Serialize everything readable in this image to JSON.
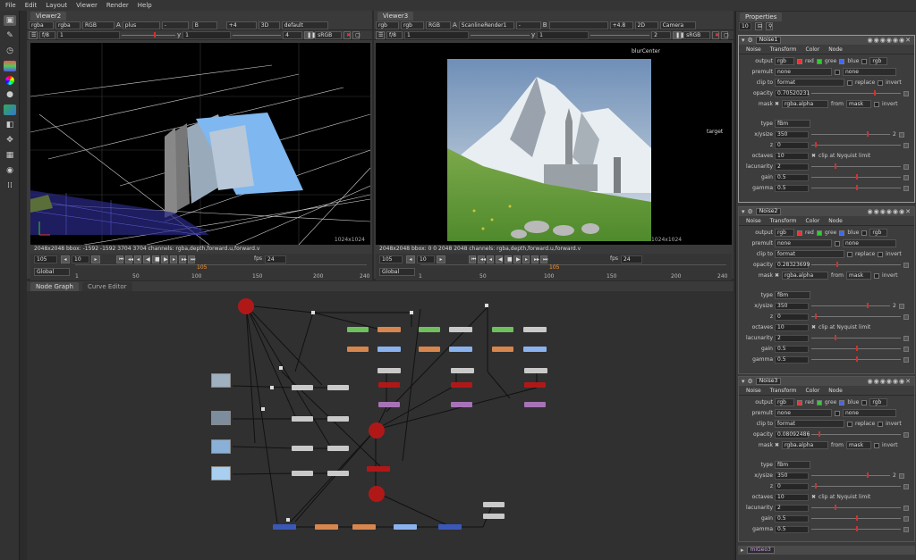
{
  "menu": [
    "File",
    "Edit",
    "Layout",
    "Viewer",
    "Render",
    "Help"
  ],
  "viewer_left": {
    "tab": "Viewer2",
    "row1": [
      "rgba",
      "rgba",
      "RGB",
      "A",
      "plus",
      "-",
      "B",
      "",
      "+4",
      "3D",
      "default"
    ],
    "row2": [
      "f/8",
      "1",
      "y",
      "1",
      "4",
      "sRGB"
    ],
    "status": "2048x2048  bbox: -1592 -1592 3704 3704 channels: rgba,depth,forward.u,forward.v",
    "resolution": "1024x1024",
    "frame": "105",
    "step": "10",
    "fps_label": "fps",
    "fps": "24",
    "range": "Global",
    "ticks": [
      "1",
      "50",
      "100",
      "150",
      "200",
      "240"
    ],
    "marker": "105"
  },
  "viewer_right": {
    "tab": "Viewer3",
    "row1": [
      "rgb",
      "rgb",
      "RGB",
      "A",
      "ScanlineRender1",
      "-",
      "B",
      "",
      "+4.8",
      "2D",
      "Camera"
    ],
    "row2": [
      "f/8",
      "1",
      "y",
      "1",
      "2",
      "sRGB"
    ],
    "status": "2048x2048  bbox: 0 0 2048 2048 channels: rgba,depth,forward.u,forward.v",
    "resolution": "1024x1024",
    "label_blur": "blurCenter",
    "label_target": "target",
    "frame": "105",
    "step": "10",
    "fps_label": "fps",
    "fps": "24",
    "range": "Global",
    "ticks": [
      "1",
      "50",
      "100",
      "150",
      "200",
      "240"
    ],
    "marker": "105"
  },
  "nodegraph": {
    "tabs": [
      "Node Graph",
      "Curve Editor"
    ]
  },
  "properties": {
    "title": "Properties",
    "count": "10",
    "panels": [
      {
        "name": "Noise1",
        "opacity": "0.70520231",
        "mask": "rgba.alpha"
      },
      {
        "name": "Noise2",
        "opacity": "0.28323699",
        "mask": "rgba.alpha"
      },
      {
        "name": "Noise3",
        "opacity": "0.08092486",
        "mask": "rgba.alpha"
      }
    ],
    "tabs": [
      "Noise",
      "Transform",
      "Color",
      "Node"
    ],
    "labels": {
      "output": "output",
      "premult": "premult",
      "clip_to": "clip to",
      "opacity": "opacity",
      "mask": "mask",
      "type": "type",
      "xysize": "x/ysize",
      "z": "z",
      "octaves": "octaves",
      "lacunarity": "lacunarity",
      "gain": "gain",
      "gamma": "gamma"
    },
    "values": {
      "output": "rgb",
      "red": "red",
      "green": "gree",
      "blue": "blue",
      "rgb2": "rgb",
      "premult": "none",
      "premult2": "none",
      "clip": "format",
      "replace": "replace",
      "invert": "invert",
      "from": "from",
      "mask_from": "mask",
      "type": "fBm",
      "xysize": "350",
      "xy2": "2",
      "z": "0",
      "octaves": "10",
      "clip_nyquist": "clip at Nyquist limit",
      "lacunarity": "2",
      "gain": "0.5",
      "gamma": "0.5"
    },
    "bottom": "miGeo3"
  }
}
